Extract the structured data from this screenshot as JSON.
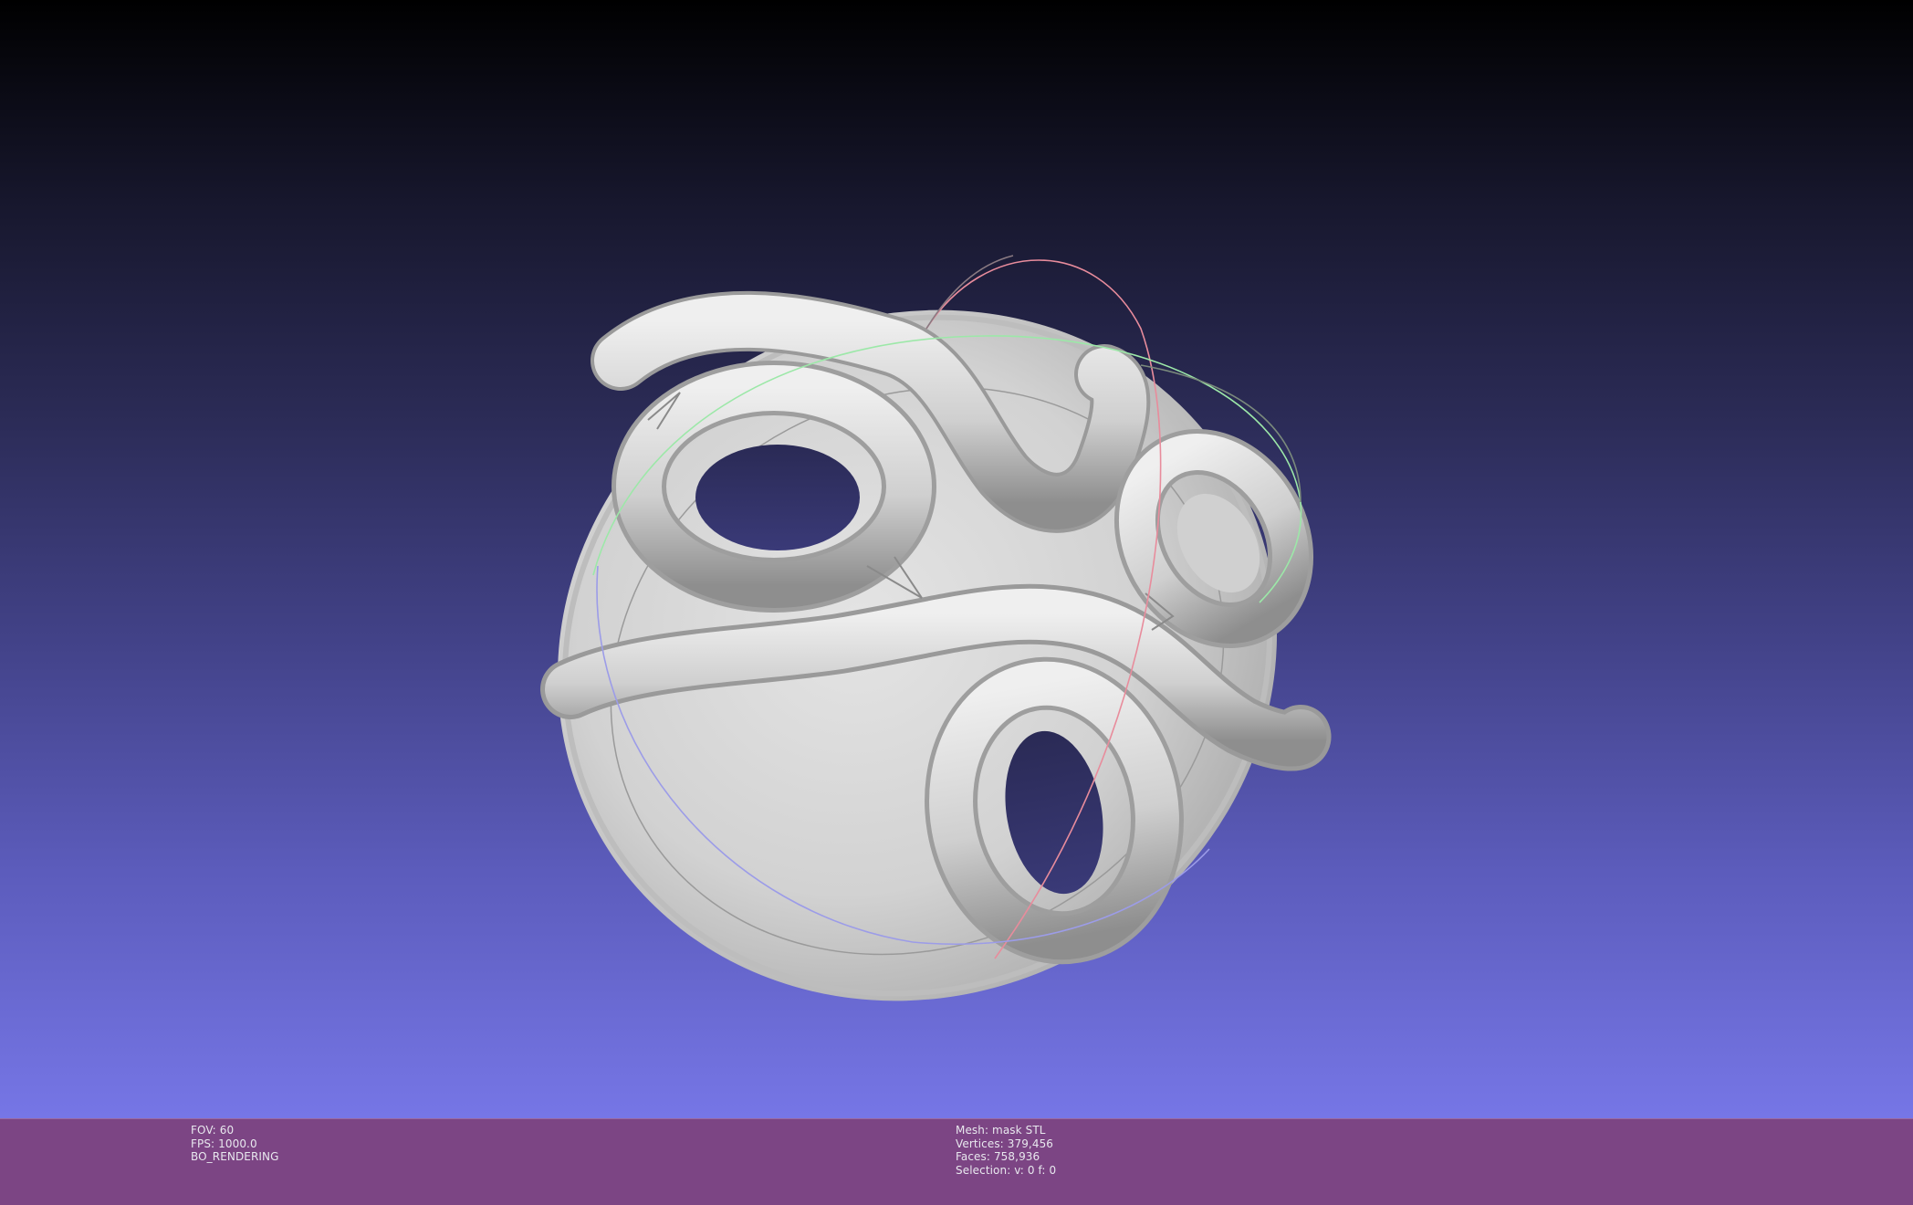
{
  "render_info": {
    "fov": "FOV: 60",
    "fps": "FPS:  1000.0",
    "mode": "BO_RENDERING"
  },
  "mesh_info": {
    "mesh": "Mesh: mask STL",
    "vertices": "Vertices: 379,456",
    "faces": "Faces: 758,936",
    "selection": "Selection: v: 0 f: 0"
  },
  "colors": {
    "status_bar": "#7c4584",
    "background_top": "#000000",
    "background_bottom": "#7676e6",
    "mesh": "#d4d4d4",
    "trackball_x": "#e88c9c",
    "trackball_y": "#9ce8a8",
    "trackball_z": "#9c9ce8"
  },
  "icons": {
    "trackball": "trackball-gizmo",
    "model": "mask-mesh"
  }
}
